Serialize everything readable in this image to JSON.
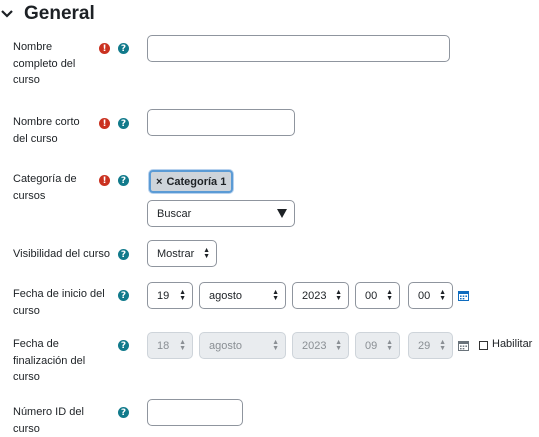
{
  "section": {
    "title": "General"
  },
  "fields": {
    "fullname": {
      "label": "Nombre completo del curso",
      "value": ""
    },
    "shortname": {
      "label": "Nombre corto del curso",
      "value": ""
    },
    "category": {
      "label": "Categoría de cursos",
      "selected": "Categoría 1",
      "remove_glyph": "×",
      "search_placeholder": "Buscar"
    },
    "visibility": {
      "label": "Visibilidad del curso",
      "value": "Mostrar"
    },
    "startdate": {
      "label": "Fecha de inicio del curso",
      "day": "19",
      "month": "agosto",
      "year": "2023",
      "hour": "00",
      "minute": "00"
    },
    "enddate": {
      "label": "Fecha de finalización del curso",
      "day": "18",
      "month": "agosto",
      "year": "2023",
      "hour": "09",
      "minute": "29",
      "enable_label": "Habilitar"
    },
    "idnumber": {
      "label": "Número ID del curso",
      "value": ""
    }
  },
  "icons": {
    "required": "!",
    "help": "?"
  },
  "colors": {
    "required": "#ca3120",
    "help": "#117a8b",
    "chip_border": "#5b9bd5"
  }
}
